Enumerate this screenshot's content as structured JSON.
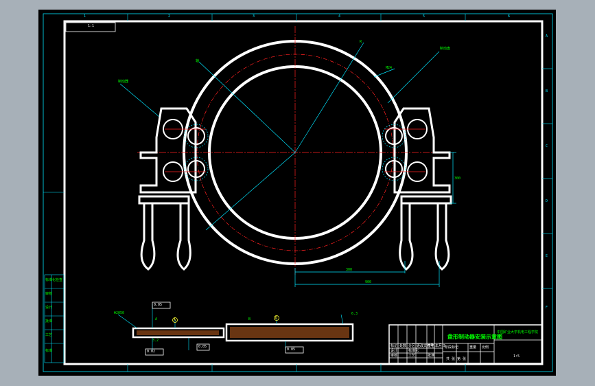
{
  "drawing": {
    "title": "盘形制动器安装示意图",
    "institution": "中国矿业大学机电工程学院",
    "scale_tag": "1:1",
    "stamp": "1:5",
    "callouts": {
      "brake_label": "制动器",
      "disc_label": "制动盘",
      "shaft_label": "轴",
      "ring_label": "M24",
      "angle_label": "R",
      "diameter_label": "Φ2050"
    },
    "dimensions": {
      "horiz_1": "300",
      "horiz_2": "900",
      "vert_1": "300",
      "tol_1": "0.05",
      "tol_2": "0.02",
      "tol_3": "0.05",
      "flat_1": "0.05",
      "datum_a": "A",
      "datum_b": "B",
      "sec_1": "A",
      "sec_2": "B",
      "rough": "3.2",
      "surface_tag": "6.3"
    },
    "left_table": [
      "标准化检查",
      "审核",
      "设计",
      "批准",
      "工艺",
      "标准"
    ],
    "border_numbers_top": [
      "1",
      "2",
      "3",
      "4",
      "5",
      "6"
    ],
    "border_letters_right": [
      "A",
      "B",
      "C",
      "D",
      "E",
      "F"
    ],
    "title_block": {
      "row1": [
        "标记",
        "处数",
        "分区",
        "更改文件号",
        "签名",
        "年月日"
      ],
      "row2": [
        "设计",
        "标准化",
        "阶段标记",
        "重量",
        "比例"
      ],
      "row3": [
        "审核",
        "工艺",
        "批准"
      ],
      "sheet": "共 张 第 张"
    }
  }
}
